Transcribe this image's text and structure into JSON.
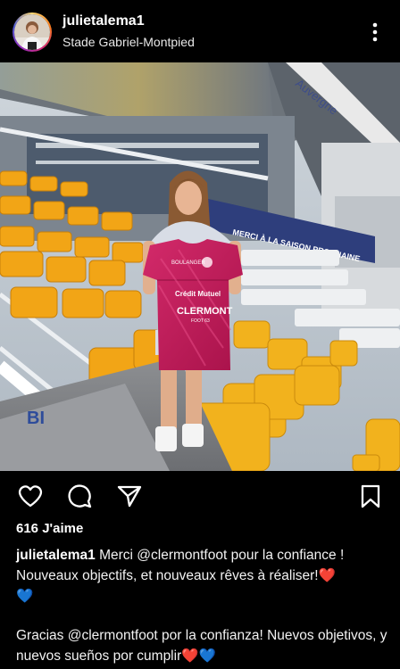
{
  "post": {
    "username": "julietalema1",
    "location": "Stade Gabriel-Montpied",
    "likes": "616 J'aime",
    "caption_user": "julietalema1",
    "caption_fr_pre": "Merci ",
    "caption_fr_mention": "@clermontfoot",
    "caption_fr_post": " pour la confiance ! Nouveaux objectifs, et nouveaux rêves à réaliser!",
    "caption_es_pre": "Gracias ",
    "caption_es_mention": "@clermontfoot",
    "caption_es_post": " por la confianza! Nuevos objetivos, y nuevos sueños por cumplir",
    "heart_red": "❤️",
    "heart_blue": "💙"
  },
  "photo": {
    "banner_text": "MERCI À LA SAISON PROCHAINE",
    "sponsor_1": "Crédit Mutuel",
    "club_name": "CLERMONT",
    "club_sub": "FOOT 63",
    "roof_text": "Auvergne",
    "wall_letters": "BI"
  },
  "colors": {
    "jersey": "#c21d5a",
    "seat": "#f2a516",
    "banner": "#2e3e7c",
    "heart_red": "#e0242b",
    "heart_blue": "#2d8ce6"
  },
  "icons": [
    "more-vertical-icon",
    "heart-icon",
    "comment-icon",
    "share-icon",
    "bookmark-icon"
  ]
}
